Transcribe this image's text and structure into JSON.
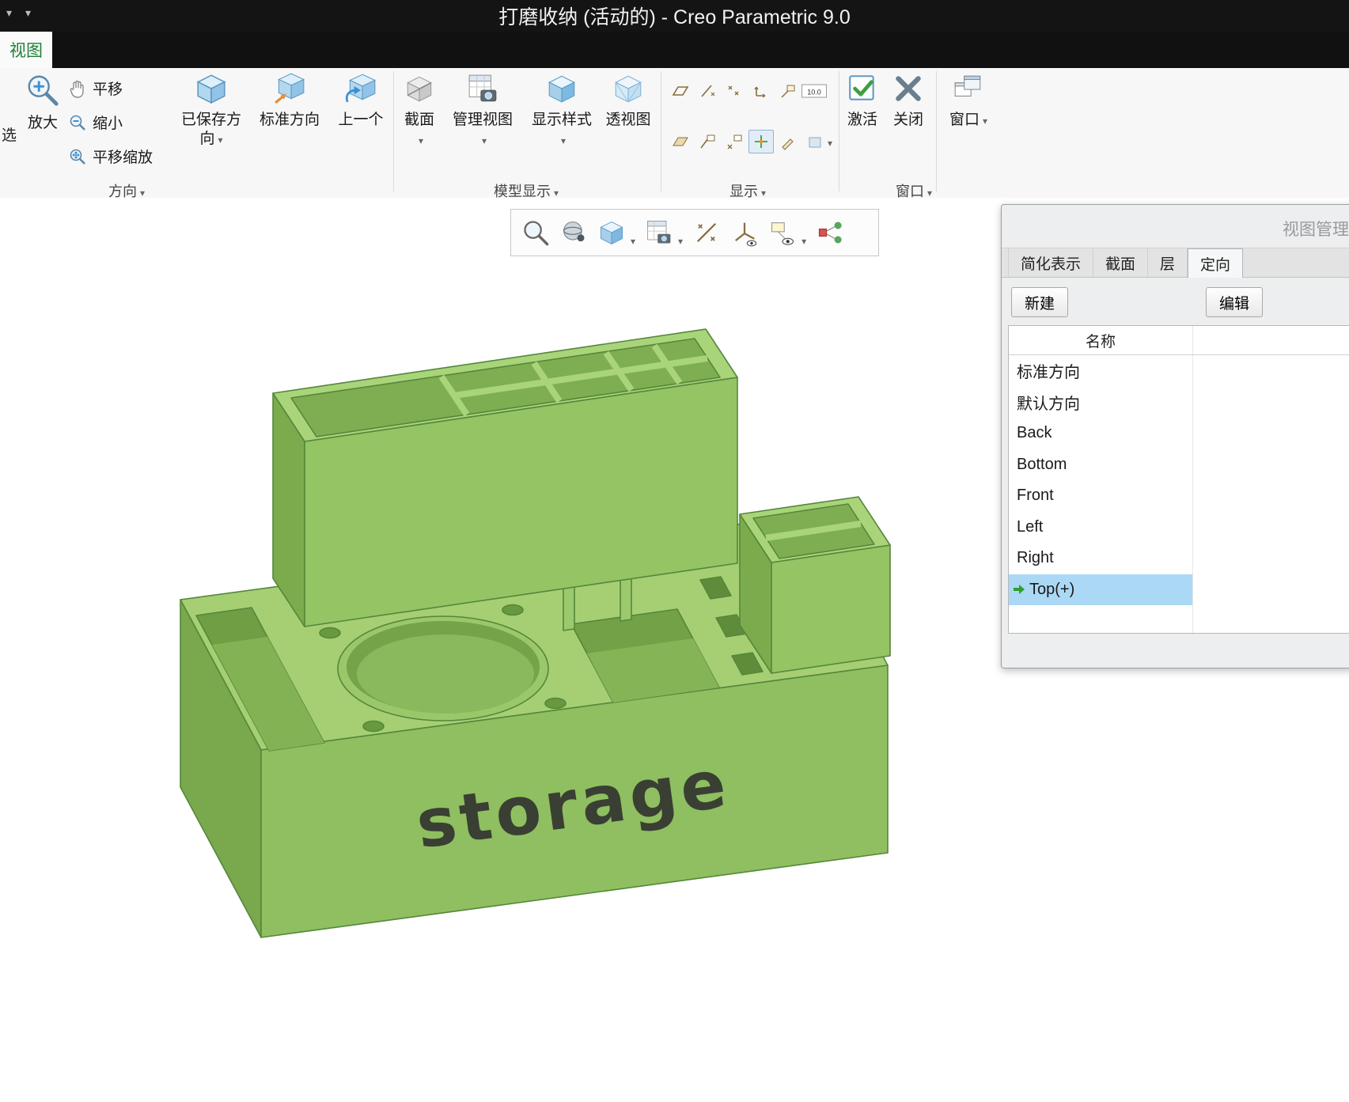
{
  "title_bar": {
    "title": "打磨收纳 (活动的) - Creo Parametric 9.0"
  },
  "ribbon": {
    "active_tab": "视图",
    "orientation_group": {
      "label": "方向",
      "cut_button": "选",
      "zoom_in": "放大",
      "pan": "平移",
      "zoom_out": "缩小",
      "pan_zoom": "平移缩放",
      "saved_orientations_line1": "已保存方",
      "saved_orientations_line2": "向",
      "standard_orientation": "标准方向",
      "previous": "上一个"
    },
    "model_display_group": {
      "label": "模型显示",
      "section": "截面",
      "manage_views": "管理视图",
      "display_style": "显示样式",
      "perspective": "透视图"
    },
    "show_group": {
      "label": "显示",
      "tolerance_toggle_text": "10.0"
    },
    "window_group": {
      "label": "窗口",
      "activate": "激活",
      "close": "关闭",
      "window": "窗口"
    }
  },
  "graphics_toolbar": {
    "icons": [
      "zoom",
      "orbit",
      "display-style",
      "view-capture",
      "datum-filters",
      "triad",
      "annotations",
      "graph"
    ]
  },
  "view_manager": {
    "title": "视图管理器",
    "tabs": [
      {
        "label": "简化表示",
        "active": false
      },
      {
        "label": "截面",
        "active": false
      },
      {
        "label": "层",
        "active": false
      },
      {
        "label": "定向",
        "active": true
      }
    ],
    "new_button": "新建",
    "edit_button": "编辑",
    "column_header": "名称",
    "views": [
      {
        "label": "标准方向",
        "selected": false
      },
      {
        "label": "默认方向",
        "selected": false
      },
      {
        "label": "Back",
        "selected": false
      },
      {
        "label": "Bottom",
        "selected": false
      },
      {
        "label": "Front",
        "selected": false
      },
      {
        "label": "Left",
        "selected": false
      },
      {
        "label": "Right",
        "selected": false
      },
      {
        "label": "Top(+)",
        "selected": true
      }
    ]
  },
  "model": {
    "text": "storage",
    "color": "#8fbf60"
  },
  "colors": {
    "selection_blue": "#abd9f5",
    "tab_active_green": "#1d8038",
    "ribbon_bg": "#f7f7f7"
  }
}
